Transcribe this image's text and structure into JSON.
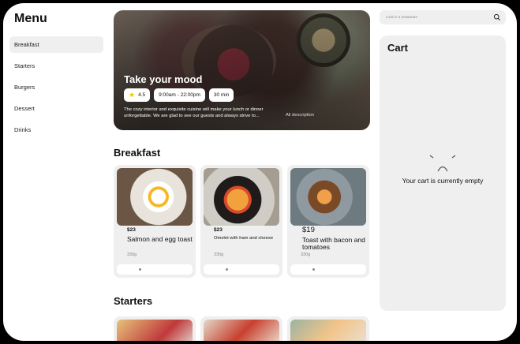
{
  "sidebar": {
    "title": "Menu",
    "items": [
      {
        "label": "Breakfast",
        "active": true
      },
      {
        "label": "Starters"
      },
      {
        "label": "Burgers"
      },
      {
        "label": "Dessert"
      },
      {
        "label": "Drinks"
      }
    ]
  },
  "hero": {
    "title": "Take your mood",
    "rating": "4.5",
    "hours": "9:00am - 22:00pm",
    "time": "30 min",
    "description": "The cozy interior and exquisite cuisine will make your lunch or dinner unforgettable. We are glad to see our guests and always strive to...",
    "all_description": "All description"
  },
  "sections": {
    "breakfast": {
      "title": "Breakfast",
      "items": [
        {
          "price": "$23",
          "name": "Salmon and egg toast",
          "weight": "330g"
        },
        {
          "price": "$23",
          "name": "Omelet with ham and cheese",
          "weight": "330g"
        },
        {
          "price": "$19",
          "name": "Toast with bacon and tomatoes",
          "weight": "330g"
        }
      ]
    },
    "starters": {
      "title": "Starters"
    }
  },
  "search": {
    "placeholder": "Look in a restaurant"
  },
  "cart": {
    "title": "Cart",
    "empty_text": "Your cart is currently empty"
  },
  "icons": {
    "search": "search-icon",
    "star": "star-icon",
    "sad_face": "sad-face-icon"
  },
  "colors": {
    "panel": "#efefef",
    "star": "#f2c200",
    "background": "#ffffff"
  }
}
